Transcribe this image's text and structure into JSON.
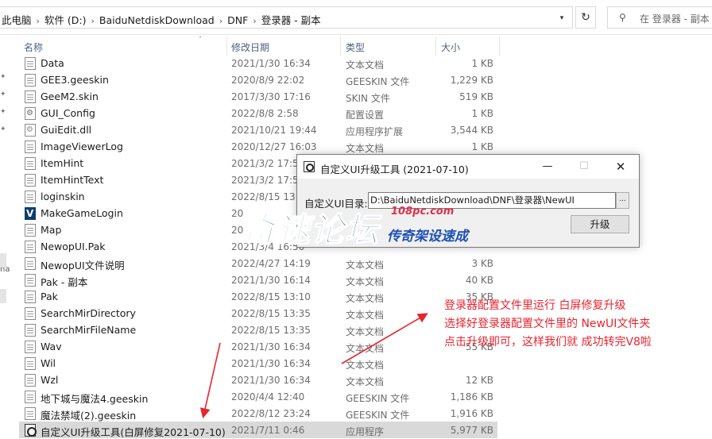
{
  "address": {
    "crumbs": [
      "此电脑",
      "软件 (D:)",
      "BaiduNetdiskDownload",
      "DNF",
      "登录器 - 副本"
    ],
    "dropdown_icon": "chevron-down-icon",
    "refresh_icon": "refresh-icon"
  },
  "search": {
    "placeholder": "在 登录器 - 副本",
    "icon": "search-icon"
  },
  "nav": {
    "fragment": "na"
  },
  "columns": {
    "name": "名称",
    "date": "修改日期",
    "type": "类型",
    "size": "大小"
  },
  "files": [
    {
      "name": "Data",
      "date": "2021/1/30 16:34",
      "type": "文本文档",
      "size": "1 KB",
      "icon": "txt"
    },
    {
      "name": "GEE3.geeskin",
      "date": "2020/8/9 22:02",
      "type": "GEESKIN 文件",
      "size": "1,229 KB",
      "icon": "txt"
    },
    {
      "name": "GeeM2.skin",
      "date": "2017/3/30 17:16",
      "type": "SKIN 文件",
      "size": "519 KB",
      "icon": "txt"
    },
    {
      "name": "GUI_Config",
      "date": "2022/8/8 2:58",
      "type": "配置设置",
      "size": "1 KB",
      "icon": "cfg"
    },
    {
      "name": "GuiEdit.dll",
      "date": "2021/10/21 19:44",
      "type": "应用程序扩展",
      "size": "3,544 KB",
      "icon": "dll"
    },
    {
      "name": "ImageViewerLog",
      "date": "2020/12/27 16:03",
      "type": "文本文档",
      "size": "1 KB",
      "icon": "txt"
    },
    {
      "name": "ItemHint",
      "date": "2021/3/2 17:57",
      "type": "",
      "size": "",
      "icon": "txt"
    },
    {
      "name": "ItemHintText",
      "date": "2021/3/2 17:57",
      "type": "",
      "size": "",
      "icon": "txt"
    },
    {
      "name": "loginskin",
      "date": "2022/8/15 13:2",
      "type": "",
      "size": "",
      "icon": "txt"
    },
    {
      "name": "MakeGameLogin",
      "date": "20",
      "type": "",
      "size": "",
      "icon": "mgl"
    },
    {
      "name": "Map",
      "date": "20",
      "type": "",
      "size": "",
      "icon": "txt"
    },
    {
      "name": "NewopUI.Pak",
      "date": "2021/3/4 16:50",
      "type": "",
      "size": "",
      "icon": "txt"
    },
    {
      "name": "NewopUI文件说明",
      "date": "2022/4/27 14:19",
      "type": "文本文档",
      "size": "3 KB",
      "icon": "txt"
    },
    {
      "name": "Pak - 副本",
      "date": "2021/1/30 16:14",
      "type": "文本文档",
      "size": "40 KB",
      "icon": "txt"
    },
    {
      "name": "Pak",
      "date": "2022/8/15 13:10",
      "type": "文本文档",
      "size": "35 KB",
      "icon": "txt"
    },
    {
      "name": "SearchMirDirectory",
      "date": "2022/8/15 13:35",
      "type": "文本文档",
      "size": "",
      "icon": "txt"
    },
    {
      "name": "SearchMirFileName",
      "date": "2022/8/15 13:35",
      "type": "文本文档",
      "size": "",
      "icon": "txt"
    },
    {
      "name": "Wav",
      "date": "2021/1/30 16:34",
      "type": "文本文档",
      "size": "55 KB",
      "icon": "txt"
    },
    {
      "name": "Wil",
      "date": "2021/1/30 16:34",
      "type": "文本文档",
      "size": "",
      "icon": "txt"
    },
    {
      "name": "Wzl",
      "date": "2021/1/30 16:34",
      "type": "文本文档",
      "size": "12 KB",
      "icon": "txt"
    },
    {
      "name": "地下城与魔法4.geeskin",
      "date": "2020/4/4 12:40",
      "type": "GEESKIN 文件",
      "size": "1,186 KB",
      "icon": "txt"
    },
    {
      "name": "魔法禁域(2).geeskin",
      "date": "2022/8/12 23:24",
      "type": "GEESKIN 文件",
      "size": "1,916 KB",
      "icon": "txt"
    },
    {
      "name": "自定义UI升级工具(白屏修复2021-07-10)",
      "date": "2021/7/11 0:46",
      "type": "应用程序",
      "size": "5,977 KB",
      "icon": "app",
      "selected": true
    }
  ],
  "dialog": {
    "title": "自定义UI升级工具 (2021-07-10)",
    "minimize": "—",
    "maximize": "☐",
    "close": "✕",
    "label": "自定义UI目录:",
    "path_value": "D:\\BaiduNetdiskDownload\\DNF\\登录器\\NewUI",
    "browse": "...",
    "upgrade": "升级"
  },
  "watermark": {
    "big": "奇速论坛",
    "url": "108pc.com",
    "sub": "传奇架设速成"
  },
  "annotation": {
    "lines": [
      "登录器配置文件里运行 白屏修复升级",
      "选择好登录器配置文件里的 NewUI文件夹",
      "点击升级即可，这样我们就 成功转完V8啦"
    ],
    "color": "#e8242f"
  }
}
